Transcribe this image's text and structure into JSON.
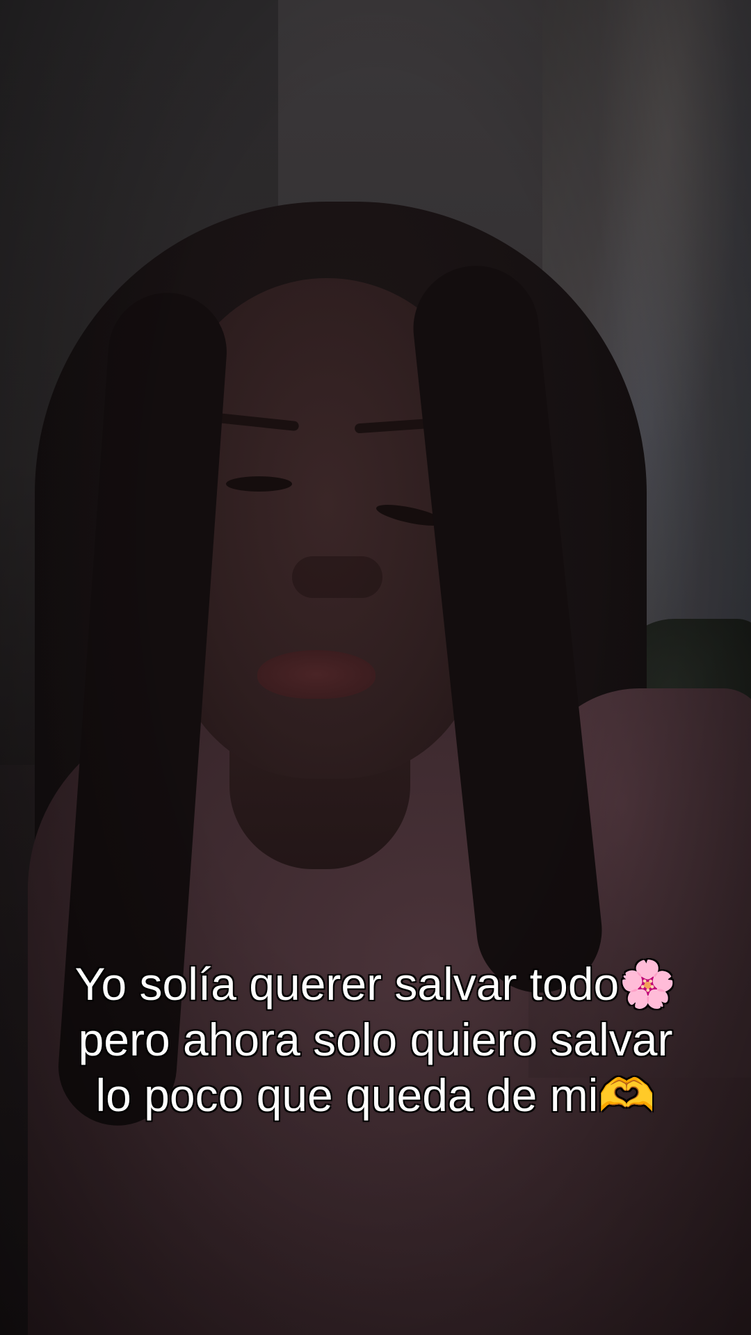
{
  "caption": {
    "line1": "Yo solía querer salvar todo🌸",
    "line2": "pero ahora solo quiero salvar",
    "line3": "lo poco que queda de mi🫶"
  }
}
